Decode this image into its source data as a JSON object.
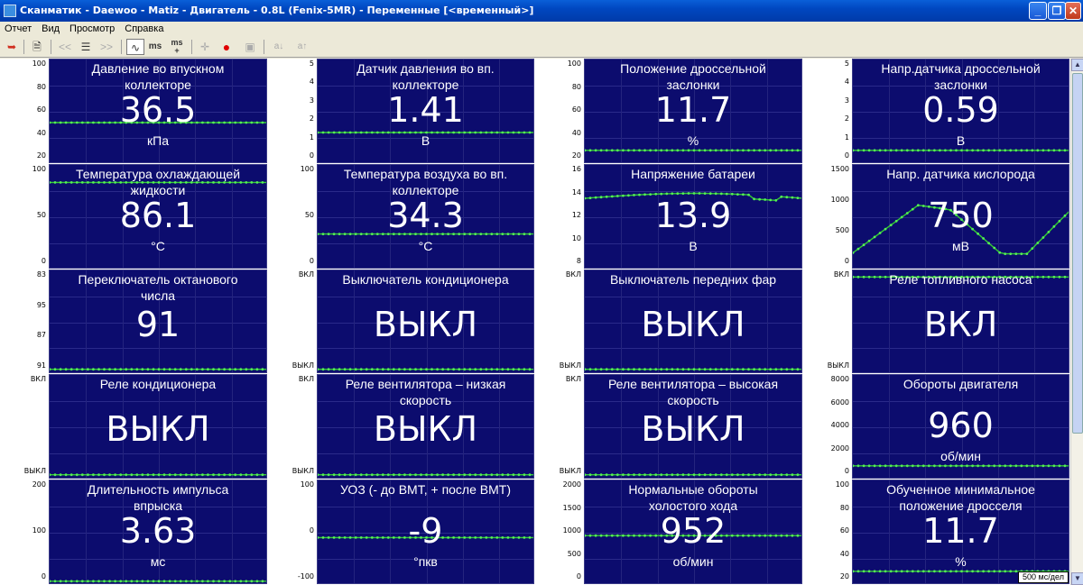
{
  "window": {
    "title": "Сканматик - Daewoo - Matiz - Двигатель - 0.8L (Fenix-5MR) - Переменные [<временный>]",
    "minimize_label": "_",
    "maximize_label": "❐",
    "close_label": "✕"
  },
  "menu": [
    "Отчет",
    "Вид",
    "Просмотр",
    "Справка"
  ],
  "toolbar": {
    "ms_label": "ms",
    "ms_plus_label": "ms\n+",
    "prev_label": "<<",
    "next_label": ">>",
    "a_down_label": "a↓",
    "a_up_label": "a↑"
  },
  "time_scale": "500 мс/дел",
  "panels": [
    {
      "title": "Давление во впускном коллекторе",
      "value": "36.5",
      "unit": "кПа",
      "ticks": [
        "100",
        "80",
        "60",
        "40",
        "20"
      ],
      "trace_level": 0.4,
      "wave": "flat"
    },
    {
      "title": "Датчик давления во вп. коллекторе",
      "value": "1.41",
      "unit": "В",
      "ticks": [
        "5",
        "4",
        "3",
        "2",
        "1",
        "0"
      ],
      "trace_level": 0.3,
      "wave": "flat"
    },
    {
      "title": "Положение дроссельной заслонки",
      "value": "11.7",
      "unit": "%",
      "ticks": [
        "100",
        "80",
        "60",
        "40",
        "20"
      ],
      "trace_level": 0.12,
      "wave": "flat"
    },
    {
      "title": "Напр.датчика дроссельной заслонки",
      "value": "0.59",
      "unit": "В",
      "ticks": [
        "5",
        "4",
        "3",
        "2",
        "1",
        "0"
      ],
      "trace_level": 0.12,
      "wave": "flat"
    },
    {
      "title": "Температура охлаждающей жидкости",
      "value": "86.1",
      "unit": "°C",
      "ticks": [
        "100",
        "50",
        "0"
      ],
      "trace_level": 0.86,
      "wave": "flat"
    },
    {
      "title": "Температура воздуха во вп. коллекторе",
      "value": "34.3",
      "unit": "°C",
      "ticks": [
        "100",
        "50",
        "0"
      ],
      "trace_level": 0.34,
      "wave": "flat"
    },
    {
      "title": "Напряжение батареи",
      "value": "13.9",
      "unit": "В",
      "ticks": [
        "16",
        "14",
        "12",
        "10",
        "8"
      ],
      "trace_level": 0.74,
      "wave": "battery"
    },
    {
      "title": "Напр. датчика кислорода",
      "value": "750",
      "unit": "мВ",
      "ticks": [
        "1500",
        "1000",
        "500",
        "0"
      ],
      "trace_level": 0.5,
      "wave": "oxygen"
    },
    {
      "title": "Переключатель октанового числа",
      "value": "91",
      "unit": "",
      "ticks": [
        "83",
        "95",
        "87",
        "91"
      ],
      "trace_level": 0.03,
      "wave": "flat"
    },
    {
      "title": "Выключатель кондиционера",
      "value": "ВЫКЛ",
      "unit": "",
      "ticks": [
        "ВКЛ",
        "ВЫКЛ"
      ],
      "trace_level": 0.03,
      "wave": "flat"
    },
    {
      "title": "Выключатель передних фар",
      "value": "ВЫКЛ",
      "unit": "",
      "ticks": [
        "ВКЛ",
        "ВЫКЛ"
      ],
      "trace_level": 0.03,
      "wave": "flat"
    },
    {
      "title": "Реле топливного насоса",
      "value": "ВКЛ",
      "unit": "",
      "ticks": [
        "ВКЛ",
        "ВЫКЛ"
      ],
      "trace_level": 0.97,
      "wave": "flat"
    },
    {
      "title": "Реле кондиционера",
      "value": "ВЫКЛ",
      "unit": "",
      "ticks": [
        "ВКЛ",
        "ВЫКЛ"
      ],
      "trace_level": 0.03,
      "wave": "flat"
    },
    {
      "title": "Реле вентилятора – низкая скорость",
      "value": "ВЫКЛ",
      "unit": "",
      "ticks": [
        "ВКЛ",
        "ВЫКЛ"
      ],
      "trace_level": 0.03,
      "wave": "flat"
    },
    {
      "title": "Реле вентилятора – высокая скорость",
      "value": "ВЫКЛ",
      "unit": "",
      "ticks": [
        "ВКЛ",
        "ВЫКЛ"
      ],
      "trace_level": 0.03,
      "wave": "flat"
    },
    {
      "title": "Обороты двигателя",
      "value": "960",
      "unit": "об/мин",
      "ticks": [
        "8000",
        "6000",
        "4000",
        "2000",
        "0"
      ],
      "trace_level": 0.12,
      "wave": "flat"
    },
    {
      "title": "Длительность импульса впрыска",
      "value": "3.63",
      "unit": "мс",
      "ticks": [
        "200",
        "100",
        "0"
      ],
      "trace_level": 0.02,
      "wave": "flat"
    },
    {
      "title": "УОЗ (- до ВМТ, + после ВМТ)",
      "value": "-9",
      "unit": "°пкв",
      "ticks": [
        "100",
        "0",
        "-100"
      ],
      "trace_level": 0.46,
      "wave": "flat"
    },
    {
      "title": "Нормальные обороты холостого хода",
      "value": "952",
      "unit": "об/мин",
      "ticks": [
        "2000",
        "1500",
        "1000",
        "500",
        "0"
      ],
      "trace_level": 0.48,
      "wave": "flat"
    },
    {
      "title": "Обученное минимальное положение дросселя",
      "value": "11.7",
      "unit": "%",
      "ticks": [
        "100",
        "80",
        "60",
        "40",
        "20"
      ],
      "trace_level": 0.12,
      "wave": "flat"
    }
  ]
}
